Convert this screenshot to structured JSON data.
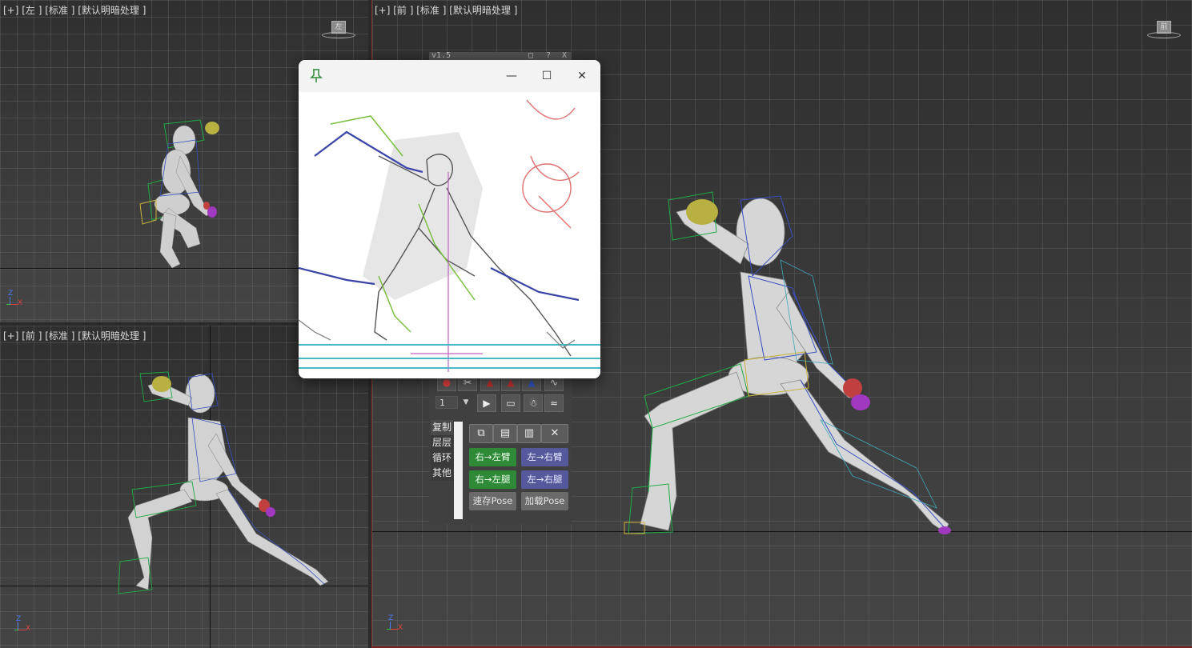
{
  "viewports": {
    "left": {
      "label": "[+] [左 ] [标准 ] [默认明暗处理 ]",
      "cube": "左"
    },
    "front_small": {
      "label": "[+] [前 ] [标准 ] [默认明暗处理 ]"
    },
    "front_large": {
      "label": "[+] [前 ] [标准 ] [默认明暗处理 ]",
      "cube": "前"
    }
  },
  "axis": {
    "z": "Z",
    "x": "X"
  },
  "tool_strip": {
    "version": "v1.5",
    "restore": "□",
    "help": "?",
    "close": "X"
  },
  "reference_window": {
    "pin_icon": "pin-icon",
    "minimize": "—",
    "maximize": "☐",
    "close": "✕"
  },
  "tool_panel": {
    "frame_value": "1",
    "frame_dropdown": "▼",
    "side_tabs": [
      "复制",
      "层层",
      "循环",
      "其他"
    ],
    "buttons": {
      "right_to_left_arm": "右→左臂",
      "left_to_right_arm": "左→右臂",
      "right_to_left_leg": "右→左腿",
      "left_to_right_leg": "左→右腿",
      "save_pose": "速存Pose",
      "load_pose": "加载Pose"
    }
  },
  "colors": {
    "viewport_bg": "#3d3d3d",
    "green_button": "#2f8a38",
    "purple_button": "#55589a",
    "gray_button": "#6a6a6a"
  }
}
